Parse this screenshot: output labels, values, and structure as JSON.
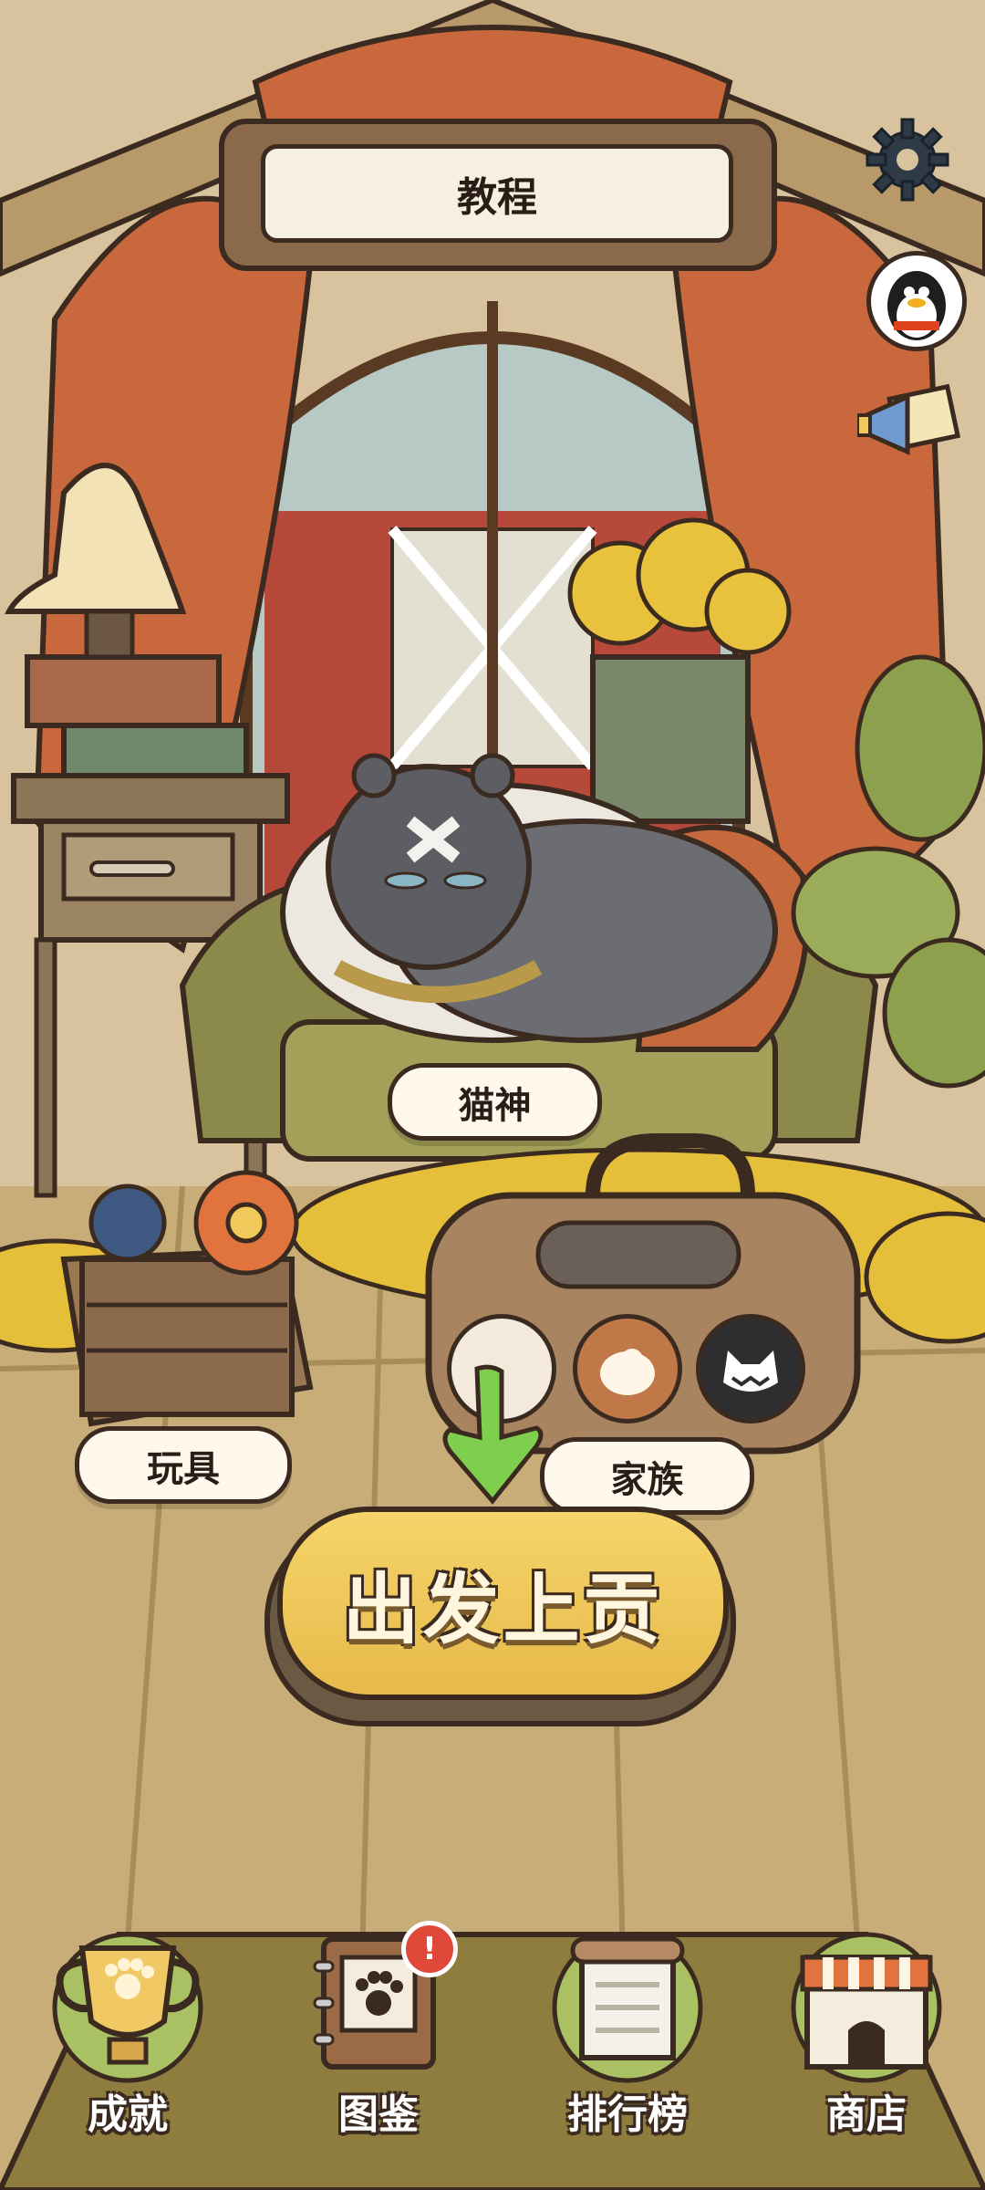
{
  "title_sign": {
    "text": "教程"
  },
  "cat_name_label": "猫神",
  "toys_label": "玩具",
  "family_label": "家族",
  "main_action_label": "出发上贡",
  "bottom_nav": [
    {
      "label": "成就",
      "icon": "trophy-icon"
    },
    {
      "label": "图鉴",
      "icon": "catalog-book-icon",
      "badge": "!"
    },
    {
      "label": "排行榜",
      "icon": "scroll-icon"
    },
    {
      "label": "商店",
      "icon": "shop-icon"
    }
  ],
  "top_right_icons": [
    "settings-gear-icon",
    "qq-penguin-icon",
    "megaphone-mail-icon"
  ],
  "family_slots": [
    "cat-avatar-slot-1",
    "cat-avatar-slot-2",
    "cat-avatar-slot-3"
  ],
  "colors": {
    "curtain": "#c9683c",
    "floor": "#cbb27f",
    "wall": "#d8c29e",
    "button_yellow": "#f0c95a",
    "outline": "#3b2a20",
    "green_arrow": "#7ecf4e"
  }
}
